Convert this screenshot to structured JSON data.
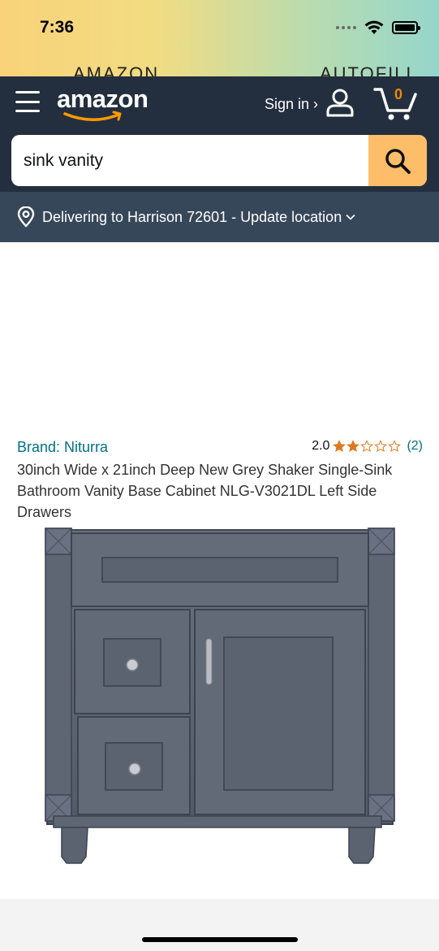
{
  "status_bar": {
    "time": "7:36",
    "icons": [
      "signal-dots-icon",
      "wifi-icon",
      "battery-icon"
    ]
  },
  "peek": {
    "left_label": "AMAZON",
    "right_label": "AUTOFILL"
  },
  "header": {
    "logo_text": "amazon",
    "signin_label": "Sign in ›",
    "cart_count": "0",
    "colors": {
      "background": "#232f3e",
      "accent": "#f08804"
    }
  },
  "search": {
    "value": "sink vanity",
    "button_color": "#febd69"
  },
  "location": {
    "text": "Delivering to Harrison 72601 - Update location"
  },
  "product": {
    "brand": "Brand: Niturra",
    "rating_value": "2.0",
    "rating_stars_filled": 2,
    "rating_stars_total": 5,
    "rating_count": "(2)",
    "title": "30inch Wide x 21inch Deep New Grey Shaker Single-Sink Bathroom Vanity Base Cabinet NLG-V3021DL Left Side Drawers",
    "image_color": "#5d6574"
  }
}
